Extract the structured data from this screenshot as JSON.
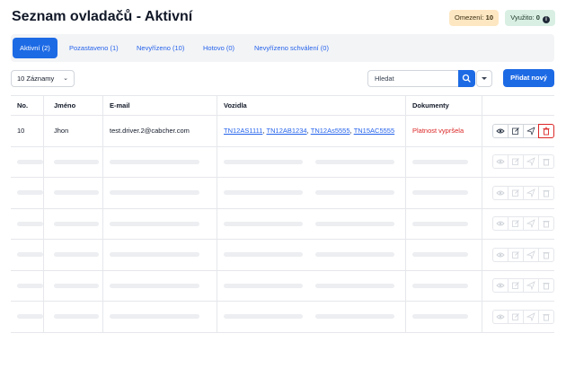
{
  "header": {
    "title": "Seznam ovladačů - Aktivní",
    "limited_label": "Omezení:",
    "limited_value": "10",
    "used_label": "Využito:",
    "used_value": "0"
  },
  "tabs": [
    {
      "label": "Aktivní (2)",
      "active": true
    },
    {
      "label": "Pozastaveno (1)",
      "active": false
    },
    {
      "label": "Nevyřízeno (10)",
      "active": false
    },
    {
      "label": "Hotovo (0)",
      "active": false
    },
    {
      "label": "Nevyřízeno schválení (0)",
      "active": false
    }
  ],
  "toolbar": {
    "page_size": "10 Záznamy",
    "search_placeholder": "Hledat",
    "add_button": "Přidat nový"
  },
  "table": {
    "columns": [
      "No.",
      "Jméno",
      "E-mail",
      "Vozidla",
      "Dokumenty"
    ],
    "rows": [
      {
        "no": "10",
        "name": "Jhon",
        "email": "test.driver.2@cabcher.com",
        "vehicles": [
          "TN12AS1111",
          "TN12AB1234",
          "TN12As5555",
          "TN15AC5555"
        ],
        "documents": "Platnost vypršela"
      }
    ],
    "skeleton_rows": 6
  },
  "icons": {
    "view": "eye-icon",
    "edit": "edit-icon",
    "send": "send-icon",
    "delete": "trash-icon",
    "search": "search-icon",
    "info": "info-icon",
    "dropdown": "chevron-down-icon"
  },
  "colors": {
    "primary": "#1d6ae5",
    "danger": "#dc2626",
    "badge_limited_bg": "#fde7c2",
    "badge_used_bg": "#d9efe3"
  }
}
